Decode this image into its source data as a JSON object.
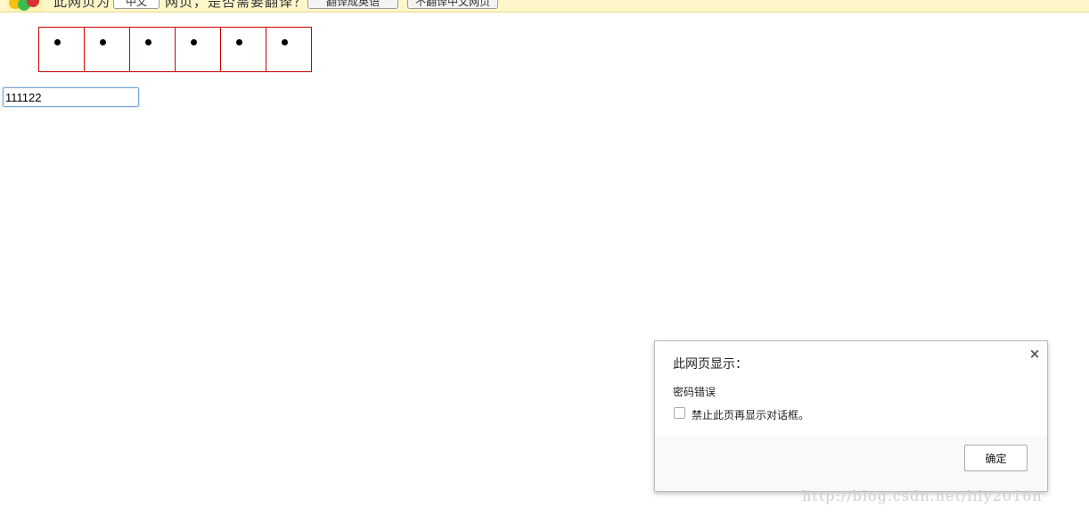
{
  "infobar": {
    "prompt_prefix": "此网页为",
    "language_value": "中文",
    "prompt_suffix": "网页，是否需要翻译？",
    "translate_button": "翻译成英语",
    "never_translate_button": "不翻译中文网页"
  },
  "password_grid": {
    "cells": [
      "•",
      "•",
      "•",
      "•",
      "•",
      "•"
    ]
  },
  "password_input": {
    "value": "111122"
  },
  "dialog": {
    "title": "此网页显示：",
    "close_label": "×",
    "message": "密码错误",
    "checkbox_label": "禁止此页再显示对话框。",
    "ok_label": "确定"
  },
  "watermark": {
    "text": "http://blog.csdn.net/lily2016n"
  },
  "colors": {
    "grid_border": "#cc0000",
    "infobar_bg": "#fff7c9",
    "input_focus": "#7aa6d8"
  }
}
